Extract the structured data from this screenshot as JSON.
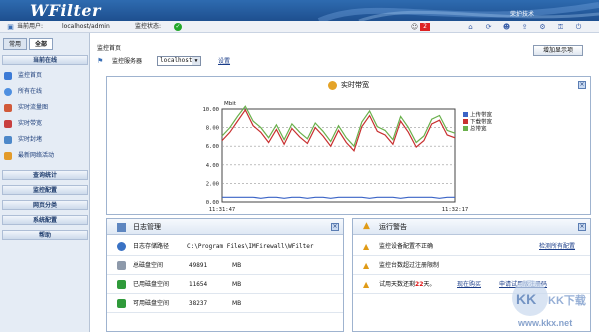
{
  "header": {
    "logo": "WFilter",
    "right_text": "荣护技术"
  },
  "status_bar": {
    "current_user_label": "当前用户:",
    "current_user_value": "localhost/admin",
    "monitor_status_label": "监控状态:",
    "alert_count": "2"
  },
  "sidebar": {
    "tabs": [
      {
        "label": "常用"
      },
      {
        "label": "全部"
      }
    ],
    "section_title": "当前在线",
    "items": [
      {
        "label": "监控首页",
        "icon": "home-icon",
        "color": "#3d7bd6"
      },
      {
        "label": "所有在线",
        "icon": "users-icon",
        "color": "#4e8fe0"
      },
      {
        "label": "实时流量图",
        "icon": "traffic-icon",
        "color": "#d15a3a"
      },
      {
        "label": "实时带宽",
        "icon": "bandwidth-icon",
        "color": "#c83f3f"
      },
      {
        "label": "实时封堵",
        "icon": "block-icon",
        "color": "#4d88c9"
      },
      {
        "label": "最新网络活动",
        "icon": "activity-icon",
        "color": "#e39b2a"
      }
    ],
    "sections": [
      {
        "label": "查询统计"
      },
      {
        "label": "监控配置"
      },
      {
        "label": "网页分类"
      },
      {
        "label": "系统配置"
      },
      {
        "label": "帮助"
      }
    ]
  },
  "main": {
    "breadcrumb": "监控首页",
    "server_label": "监控服务器",
    "server_value": "localhost",
    "settings_link": "设置",
    "add_button": "增加显示项"
  },
  "bandwidth_panel": {
    "title": "实时带宽"
  },
  "chart_data": {
    "type": "line",
    "title": "实时带宽",
    "ylabel": "Mbit",
    "ylim": [
      0,
      10
    ],
    "y_ticks": [
      "10.00",
      "8.00",
      "6.00",
      "4.00",
      "2.00",
      "0.00"
    ],
    "x_start": "11:31:47",
    "x_end": "11:32:17",
    "legend_position": "right",
    "x": [
      0,
      1,
      2,
      3,
      4,
      5,
      6,
      7,
      8,
      9,
      10,
      11,
      12,
      13,
      14,
      15,
      16,
      17,
      18,
      19,
      20,
      21,
      22,
      23,
      24,
      25,
      26,
      27,
      28,
      29,
      30
    ],
    "series": [
      {
        "name": "上传带宽",
        "color": "#3b64c6",
        "values": [
          0.5,
          0.5,
          0.5,
          0.5,
          0.5,
          0.4,
          0.5,
          0.5,
          0.4,
          0.5,
          0.5,
          0.4,
          0.5,
          0.5,
          0.4,
          0.5,
          0.5,
          0.5,
          0.5,
          0.4,
          0.5,
          0.5,
          0.5,
          0.4,
          0.5,
          0.5,
          0.5,
          0.5,
          0.4,
          0.5,
          0.5
        ]
      },
      {
        "name": "下载带宽",
        "color": "#c83030",
        "values": [
          6.6,
          7.5,
          8.7,
          9.9,
          8.2,
          7.5,
          6.4,
          7.8,
          6.2,
          7.9,
          7.0,
          6.3,
          8.0,
          7.1,
          6.0,
          7.7,
          6.4,
          5.5,
          8.1,
          9.3,
          7.6,
          7.2,
          6.2,
          8.7,
          7.5,
          5.9,
          6.6,
          8.4,
          8.8,
          7.2,
          6.9
        ]
      },
      {
        "name": "总带宽",
        "color": "#6ab04c",
        "values": [
          7.1,
          8.0,
          9.2,
          10.3,
          8.7,
          8.0,
          6.9,
          8.3,
          6.7,
          8.4,
          7.5,
          6.8,
          8.5,
          7.6,
          6.5,
          8.2,
          6.9,
          6.0,
          8.6,
          9.8,
          8.1,
          7.7,
          6.7,
          9.2,
          8.0,
          6.4,
          7.1,
          8.9,
          9.3,
          7.7,
          7.4
        ]
      }
    ]
  },
  "log_panel": {
    "title": "日志管理",
    "rows": [
      {
        "label": "日志存储路径",
        "value": "C:\\Program Files\\IMFirewall\\WFilter",
        "unit": ""
      },
      {
        "label": "总磁盘空间",
        "value": "49891",
        "unit": "MB"
      },
      {
        "label": "已用磁盘空间",
        "value": "11654",
        "unit": "MB"
      },
      {
        "label": "可用磁盘空间",
        "value": "38237",
        "unit": "MB"
      }
    ]
  },
  "alert_panel": {
    "title": "运行警告",
    "rows": [
      {
        "text": "监控设备配置不正确",
        "link": "检测所有配置"
      },
      {
        "text": "监控台数超过注册限制",
        "link": ""
      },
      {
        "text_prefix": "试用天数还剩",
        "days": "22",
        "text_suffix": "天。",
        "buy": "现在购买",
        "reg": "申请试用版注册码"
      }
    ]
  },
  "watermark": {
    "text1": "KK下载",
    "text2": "www.kkx.net"
  }
}
